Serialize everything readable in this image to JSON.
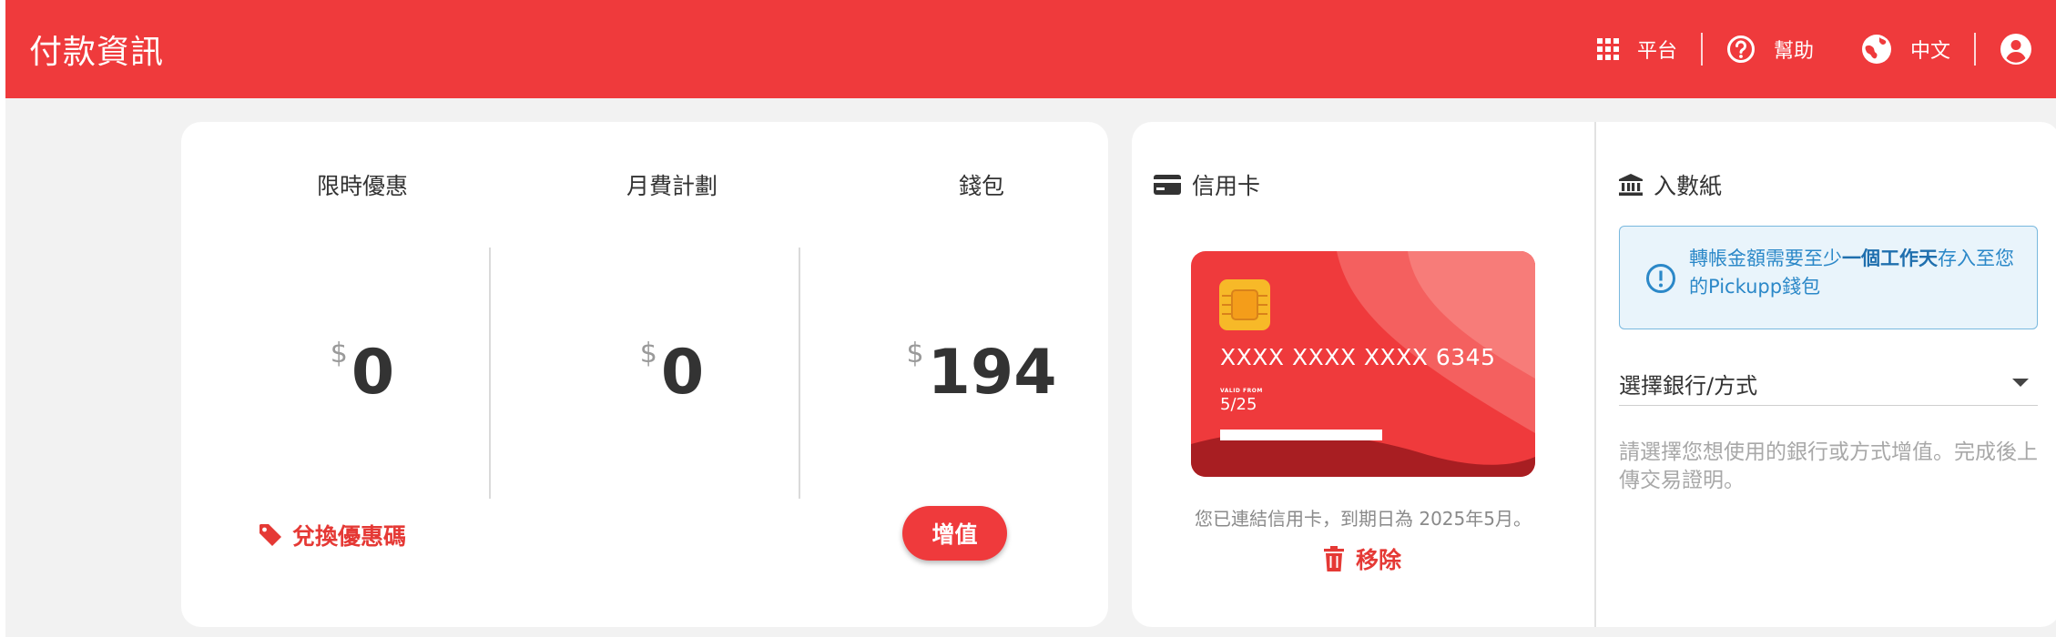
{
  "header": {
    "title": "付款資訊",
    "nav": {
      "platform": "平台",
      "help": "幫助",
      "language": "中文"
    }
  },
  "balances": {
    "promo": {
      "label": "限時優惠",
      "currency": "$",
      "amount": "0"
    },
    "plan": {
      "label": "月費計劃",
      "currency": "$",
      "amount": "0"
    },
    "wallet": {
      "label": "錢包",
      "currency": "$",
      "amount": "194"
    },
    "redeem_label": "兌換優惠碼",
    "topup_label": "增值"
  },
  "credit_card": {
    "title": "信用卡",
    "number": "XXXX XXXX XXXX 6345",
    "valid_label": "VALID FROM",
    "expiry": "5/25",
    "note": "您已連結信用卡，到期日為 2025年5月。",
    "remove_label": "移除"
  },
  "bank_slip": {
    "title": "入數紙",
    "info_pre": "轉帳金額需要至少",
    "info_bold": "一個工作天",
    "info_post": "存入至您的Pickupp錢包",
    "select_placeholder": "選擇銀行/方式",
    "hint": "請選擇您想使用的銀行或方式增值。完成後上傳交易證明。"
  },
  "colors": {
    "brand_red": "#ef3a3c",
    "info_blue": "#2b88c8",
    "card_dark": "#a81e22",
    "chip_gold": "#f7b928"
  }
}
